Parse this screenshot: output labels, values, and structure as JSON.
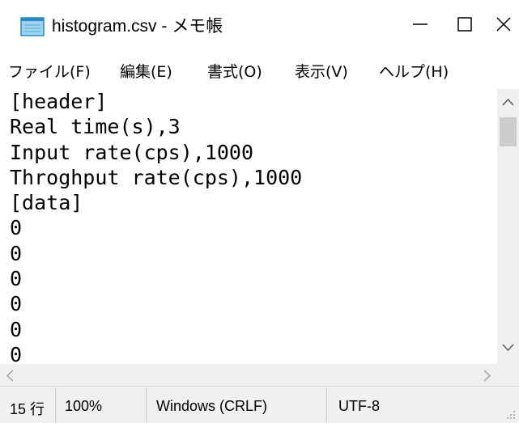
{
  "window": {
    "title": "histogram.csv - メモ帳",
    "controls": {
      "minimize_icon": "minimize-icon",
      "maximize_icon": "maximize-icon",
      "close_icon": "close-icon"
    }
  },
  "menu": {
    "items": [
      "ファイル(F)",
      "編集(E)",
      "書式(O)",
      "表示(V)",
      "ヘルプ(H)"
    ]
  },
  "editor": {
    "lines": [
      "[header]",
      "Real time(s),3",
      "Input rate(cps),1000",
      "Throghput rate(cps),1000",
      "[data]",
      "0",
      "0",
      "0",
      "0",
      "0",
      "0"
    ]
  },
  "statusbar": {
    "position": "15 行",
    "zoom": "100%",
    "line_ending": "Windows (CRLF)",
    "encoding": "UTF-8"
  }
}
